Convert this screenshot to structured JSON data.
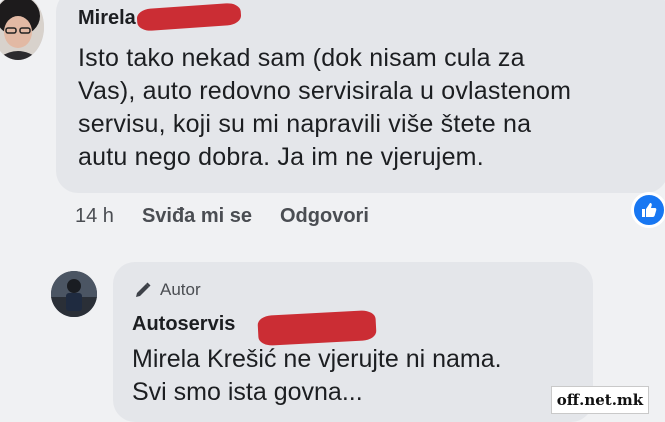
{
  "comment": {
    "author": "Mirela",
    "lines": [
      "Isto tako nekad sam (dok nisam cula za",
      "Vas), auto redovno servisirala u ovlastenom",
      "servisu, koji su mi napravili više štete na",
      "autu nego dobra. Ja im ne vjerujem."
    ],
    "time": "14 h",
    "like_label": "Sviđa mi se",
    "reply_label": "Odgovori"
  },
  "reply": {
    "badge": "Autor",
    "author": "Autoservis",
    "lines": [
      "Mirela Krešić ne vjerujte ni nama.",
      "Svi smo ista govna..."
    ]
  },
  "watermark": "off.net.mk",
  "colors": {
    "redaction": "#c9232a",
    "like": "#1877f2",
    "bubble": "#e4e6ea"
  }
}
